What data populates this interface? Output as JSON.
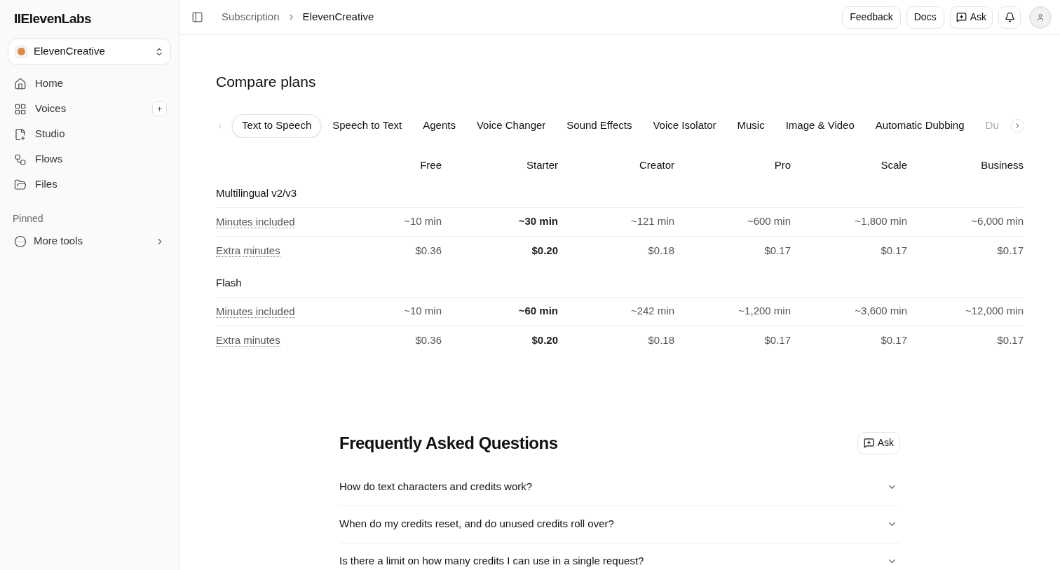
{
  "sidebar": {
    "logo": "IIElevenLabs",
    "workspace": "ElevenCreative",
    "items": [
      {
        "label": "Home",
        "kind": "home",
        "selected": false
      },
      {
        "label": "Voices",
        "kind": "voices",
        "selected": false,
        "add_button": "+"
      },
      {
        "label": "Studio",
        "kind": "studio",
        "selected": false
      },
      {
        "label": "Flows",
        "kind": "flows",
        "selected": false
      },
      {
        "label": "Files",
        "kind": "files",
        "selected": false
      }
    ],
    "pinned_heading": "Pinned",
    "pinned": [
      {
        "label": "More tools",
        "kind": "more"
      }
    ]
  },
  "header": {
    "breadcrumb": [
      "Subscription",
      "ElevenCreative"
    ],
    "buttons": [
      {
        "label": "Feedback",
        "kind": "text"
      },
      {
        "label": "Docs",
        "kind": "text"
      },
      {
        "label": "Ask",
        "kind": "ask"
      },
      {
        "kind": "bell"
      },
      {
        "kind": "avatar"
      }
    ]
  },
  "title": "Compare plans",
  "tabs": [
    {
      "label": "Text to Speech",
      "selected": true
    },
    {
      "label": "Speech to Text",
      "selected": false
    },
    {
      "label": "Agents",
      "selected": false
    },
    {
      "label": "Voice Changer",
      "selected": false
    },
    {
      "label": "Sound Effects",
      "selected": false
    },
    {
      "label": "Voice Isolator",
      "selected": false
    },
    {
      "label": "Music",
      "selected": false
    },
    {
      "label": "Image & Video",
      "selected": false
    },
    {
      "label": "Automatic Dubbing",
      "selected": false
    },
    {
      "label": "Du",
      "selected": false
    }
  ],
  "plans": [
    {
      "name": "Free",
      "highlighted": false
    },
    {
      "name": "Starter",
      "highlighted": true
    },
    {
      "name": "Creator",
      "highlighted": false
    },
    {
      "name": "Pro",
      "highlighted": false
    },
    {
      "name": "Scale",
      "highlighted": false
    },
    {
      "name": "Business",
      "highlighted": false
    }
  ],
  "sections": [
    {
      "title": "Multilingual v2/v3",
      "rows": [
        {
          "label": "Minutes included",
          "values": [
            "~10 min",
            "~30 min",
            "~121 min",
            "~600 min",
            "~1,800 min",
            "~6,000 min"
          ]
        },
        {
          "label": "Extra minutes",
          "values": [
            "$0.36",
            "$0.20",
            "$0.18",
            "$0.17",
            "$0.17",
            "$0.17"
          ]
        }
      ]
    },
    {
      "title": "Flash",
      "rows": [
        {
          "label": "Minutes included",
          "values": [
            "~10 min",
            "~60 min",
            "~242 min",
            "~1,200 min",
            "~3,600 min",
            "~12,000 min"
          ]
        },
        {
          "label": "Extra minutes",
          "values": [
            "$0.36",
            "$0.20",
            "$0.18",
            "$0.17",
            "$0.17",
            "$0.17"
          ]
        }
      ]
    }
  ],
  "faq": {
    "title": "Frequently Asked Questions",
    "ask_button": "Ask",
    "items": [
      {
        "question": "How do text characters and credits work?",
        "expanded": false
      },
      {
        "question": "When do my credits reset, and do unused credits roll over?",
        "expanded": false
      },
      {
        "question": "Is there a limit on how many credits I can use in a single request?",
        "expanded": false
      }
    ]
  }
}
